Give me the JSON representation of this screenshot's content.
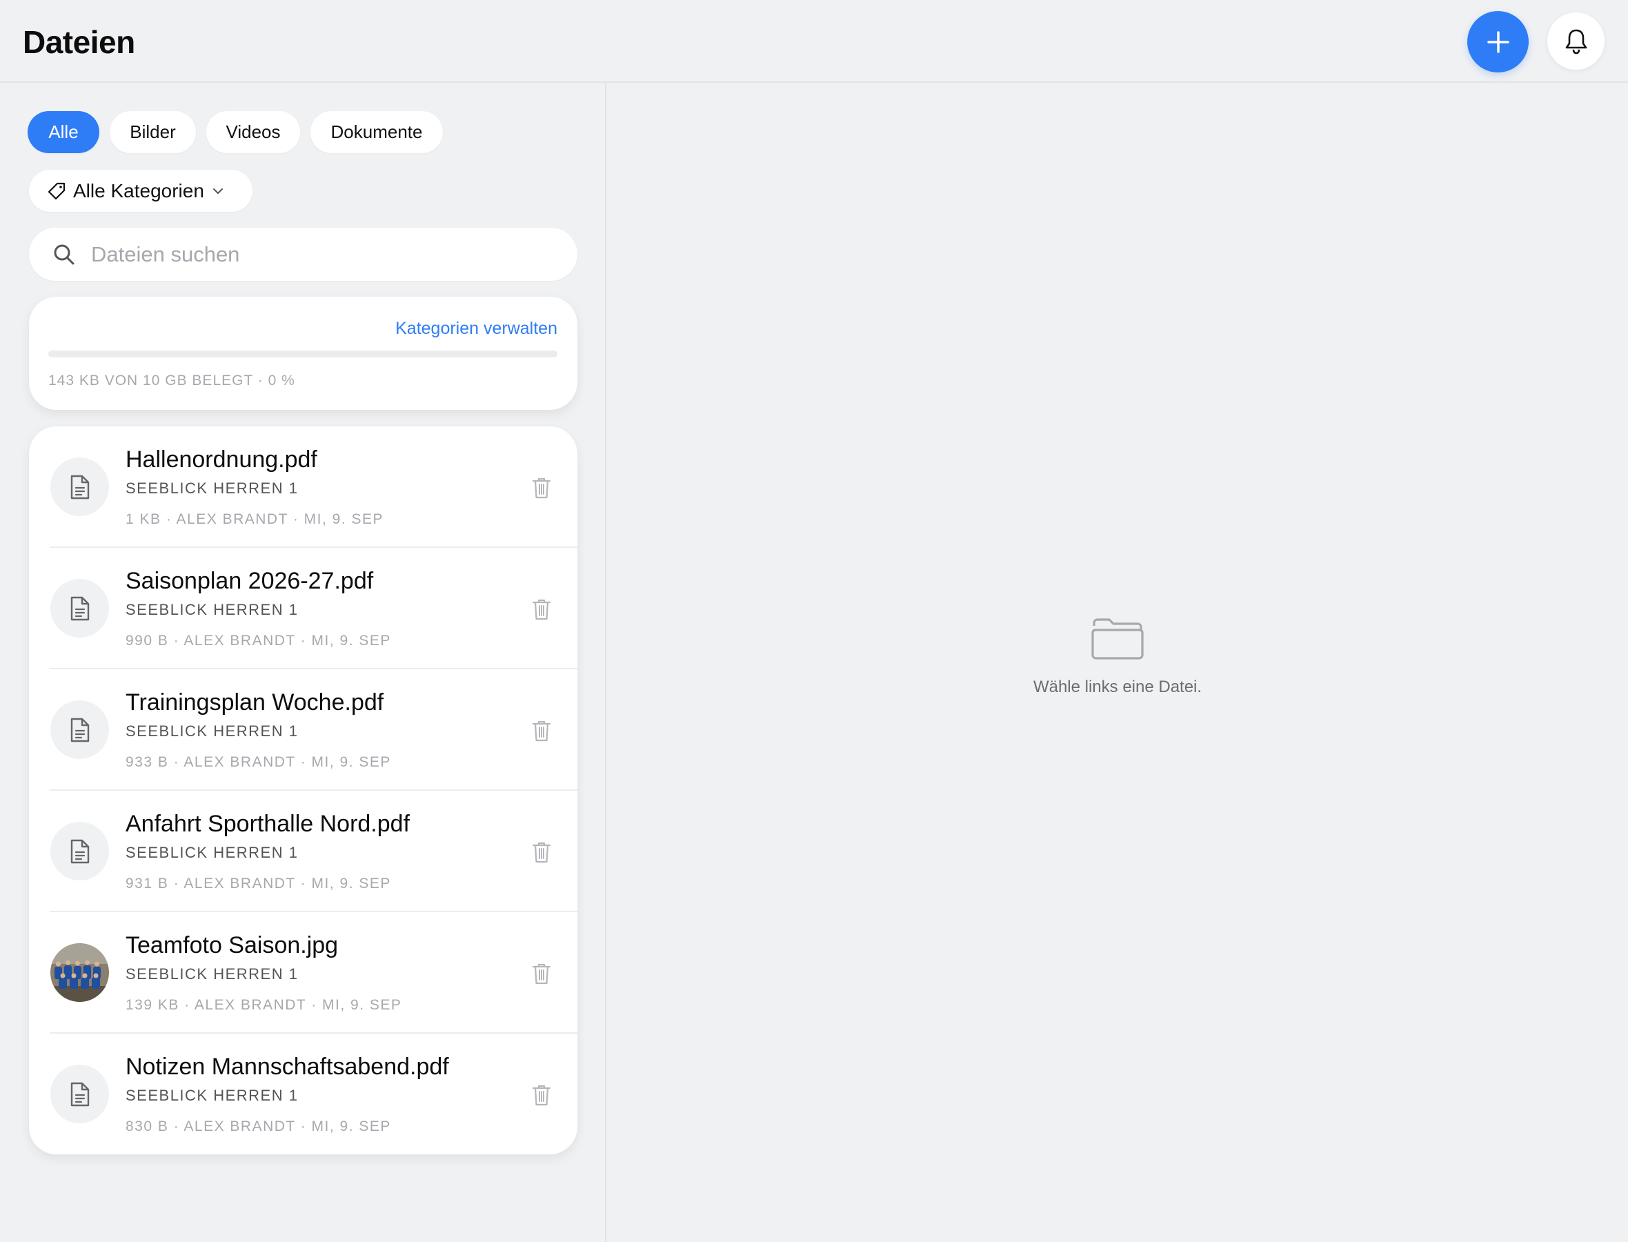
{
  "header": {
    "title": "Dateien"
  },
  "filters": {
    "chips": [
      {
        "label": "Alle",
        "active": true
      },
      {
        "label": "Bilder",
        "active": false
      },
      {
        "label": "Videos",
        "active": false
      },
      {
        "label": "Dokumente",
        "active": false
      }
    ],
    "category_label": "Alle Kategorien"
  },
  "search": {
    "placeholder": "Dateien suchen"
  },
  "storage": {
    "manage_label": "Kategorien verwalten",
    "usage_text": "143 KB von 10 GB belegt · 0 %",
    "fraction_used": 0
  },
  "files": [
    {
      "name": "Hallenordnung.pdf",
      "team": "Seeblick Herren 1",
      "meta": "1 KB · Alex Brandt · Mi, 9. Sep",
      "kind": "document"
    },
    {
      "name": "Saisonplan 2026-27.pdf",
      "team": "Seeblick Herren 1",
      "meta": "990 B · Alex Brandt · Mi, 9. Sep",
      "kind": "document"
    },
    {
      "name": "Trainingsplan Woche.pdf",
      "team": "Seeblick Herren 1",
      "meta": "933 B · Alex Brandt · Mi, 9. Sep",
      "kind": "document"
    },
    {
      "name": "Anfahrt Sporthalle Nord.pdf",
      "team": "Seeblick Herren 1",
      "meta": "931 B · Alex Brandt · Mi, 9. Sep",
      "kind": "document"
    },
    {
      "name": "Teamfoto Saison.jpg",
      "team": "Seeblick Herren 1",
      "meta": "139 KB · Alex Brandt · Mi, 9. Sep",
      "kind": "image"
    },
    {
      "name": "Notizen Mannschaftsabend.pdf",
      "team": "Seeblick Herren 1",
      "meta": "830 B · Alex Brandt · Mi, 9. Sep",
      "kind": "document"
    }
  ],
  "detail": {
    "empty_text": "Wähle links eine Datei."
  },
  "icons": {
    "add": "plus-icon",
    "notifications": "bell-icon",
    "category": "tag-icon",
    "dropdown": "chevron-down-icon",
    "search": "search-icon",
    "document": "document-icon",
    "delete": "trash-icon",
    "empty": "folder-icon"
  },
  "colors": {
    "accent": "#2f7df6",
    "background": "#f0f1f3",
    "card": "#ffffff",
    "muted_text": "#a6a8ad"
  }
}
